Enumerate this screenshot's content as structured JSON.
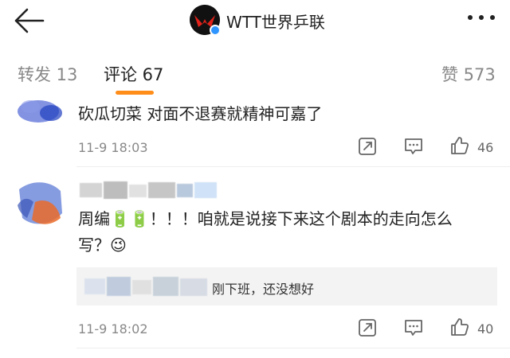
{
  "header": {
    "title": "WTT世界乒联"
  },
  "tabs": [
    {
      "label": "转发 13"
    },
    {
      "label": "评论 67"
    }
  ],
  "likes_tab": "赞 573",
  "comments": [
    {
      "text": "砍瓜切菜 对面不退赛就精神可嘉了",
      "time": "11-9 18:03",
      "likes": "46"
    },
    {
      "text_line1": "周编🔋🔋！！！咱就是说接下来这个剧本的走向怎么",
      "text_line2": "写？😉",
      "reply": "刚下班，还没想好",
      "time": "11-9 18:02",
      "likes": "40"
    }
  ],
  "icons": {
    "back": "back-arrow-icon",
    "more": "more-dots-icon",
    "share": "share-icon",
    "comment": "comment-icon",
    "like": "thumb-up-icon"
  },
  "colors": {
    "accent": "#ff8d1a",
    "verified": "#2f95ff"
  }
}
